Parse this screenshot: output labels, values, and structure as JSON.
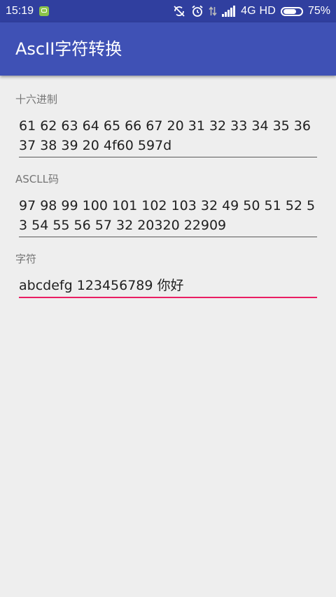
{
  "status_bar": {
    "time": "15:19",
    "network_label": "4G HD",
    "battery_percent": "75%",
    "battery_level": 0.75,
    "icons": [
      "app-notification-icon",
      "sync-off-icon",
      "alarm-icon",
      "data-arrows-icon",
      "signal-icon",
      "battery-icon"
    ]
  },
  "app_bar": {
    "title": "AscII字符转换"
  },
  "fields": [
    {
      "label": "十六进制",
      "value": "61 62 63 64 65 66 67 20 31 32 33 34 35 36 37 38 39 20 4f60 597d",
      "focused": false
    },
    {
      "label": "ASCLL码",
      "value": "97 98 99 100 101 102 103 32 49 50 51 52 53 54 55 56 57 32 20320 22909",
      "focused": false
    },
    {
      "label": "字符",
      "value": "abcdefg 123456789 你好",
      "focused": true
    }
  ],
  "colors": {
    "status_bar": "#303f9f",
    "app_bar": "#3f51b5",
    "accent": "#e91e63",
    "background": "#eeeeee"
  }
}
